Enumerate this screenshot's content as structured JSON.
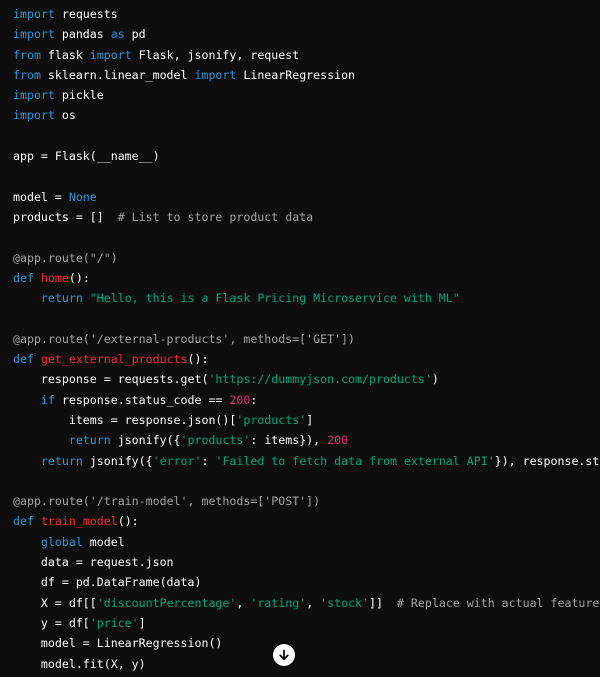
{
  "colors": {
    "background": "#0d0d0d",
    "keyword": "#2e95d3",
    "function_name": "#f22c3d",
    "string": "#00a67d",
    "number": "#df3079",
    "comment": "#a3a3a3",
    "default": "#ffffff"
  },
  "code_lines": [
    [
      [
        "kw",
        "import"
      ],
      [
        "tx",
        " requests"
      ]
    ],
    [
      [
        "kw",
        "import"
      ],
      [
        "tx",
        " pandas "
      ],
      [
        "kw",
        "as"
      ],
      [
        "tx",
        " pd"
      ]
    ],
    [
      [
        "kw",
        "from"
      ],
      [
        "tx",
        " flask "
      ],
      [
        "kw",
        "import"
      ],
      [
        "tx",
        " Flask, jsonify, request"
      ]
    ],
    [
      [
        "kw",
        "from"
      ],
      [
        "tx",
        " sklearn.linear_model "
      ],
      [
        "kw",
        "import"
      ],
      [
        "tx",
        " LinearRegression"
      ]
    ],
    [
      [
        "kw",
        "import"
      ],
      [
        "tx",
        " pickle"
      ]
    ],
    [
      [
        "kw",
        "import"
      ],
      [
        "tx",
        " os"
      ]
    ],
    [],
    [
      [
        "tx",
        "app = Flask(__name__)"
      ]
    ],
    [],
    [
      [
        "tx",
        "model = "
      ],
      [
        "kw",
        "None"
      ]
    ],
    [
      [
        "tx",
        "products = []  "
      ],
      [
        "cm",
        "# List to store product data"
      ]
    ],
    [],
    [
      [
        "cm",
        "@app.route(\"/\")"
      ]
    ],
    [
      [
        "kw",
        "def"
      ],
      [
        "tx",
        " "
      ],
      [
        "fn",
        "home"
      ],
      [
        "tx",
        "():"
      ]
    ],
    [
      [
        "tx",
        "    "
      ],
      [
        "kw",
        "return"
      ],
      [
        "tx",
        " "
      ],
      [
        "st",
        "\"Hello, this is a Flask Pricing Microservice with ML\""
      ]
    ],
    [],
    [
      [
        "cm",
        "@app.route('/external-products', methods=['GET'])"
      ]
    ],
    [
      [
        "kw",
        "def"
      ],
      [
        "tx",
        " "
      ],
      [
        "fn",
        "get_external_products"
      ],
      [
        "tx",
        "():"
      ]
    ],
    [
      [
        "tx",
        "    response = requests.get("
      ],
      [
        "st",
        "'https://dummyjson.com/products'"
      ],
      [
        "tx",
        ")"
      ]
    ],
    [
      [
        "tx",
        "    "
      ],
      [
        "kw",
        "if"
      ],
      [
        "tx",
        " response.status_code == "
      ],
      [
        "nu",
        "200"
      ],
      [
        "tx",
        ":"
      ]
    ],
    [
      [
        "tx",
        "        items = response.json()["
      ],
      [
        "st",
        "'products'"
      ],
      [
        "tx",
        "]"
      ]
    ],
    [
      [
        "tx",
        "        "
      ],
      [
        "kw",
        "return"
      ],
      [
        "tx",
        " jsonify({"
      ],
      [
        "st",
        "'products'"
      ],
      [
        "tx",
        ": items}), "
      ],
      [
        "nu",
        "200"
      ]
    ],
    [
      [
        "tx",
        "    "
      ],
      [
        "kw",
        "return"
      ],
      [
        "tx",
        " jsonify({"
      ],
      [
        "st",
        "'error'"
      ],
      [
        "tx",
        ": "
      ],
      [
        "st",
        "'Failed to fetch data from external API'"
      ],
      [
        "tx",
        "}), response.status_c"
      ]
    ],
    [],
    [
      [
        "cm",
        "@app.route('/train-model', methods=['POST'])"
      ]
    ],
    [
      [
        "kw",
        "def"
      ],
      [
        "tx",
        " "
      ],
      [
        "fn",
        "train_model"
      ],
      [
        "tx",
        "():"
      ]
    ],
    [
      [
        "tx",
        "    "
      ],
      [
        "kw",
        "global"
      ],
      [
        "tx",
        " model"
      ]
    ],
    [
      [
        "tx",
        "    data = request.json"
      ]
    ],
    [
      [
        "tx",
        "    df = pd.DataFrame(data)"
      ]
    ],
    [
      [
        "tx",
        "    X = df[["
      ],
      [
        "st",
        "'discountPercentage'"
      ],
      [
        "tx",
        ", "
      ],
      [
        "st",
        "'rating'"
      ],
      [
        "tx",
        ", "
      ],
      [
        "st",
        "'stock'"
      ],
      [
        "tx",
        "]]  "
      ],
      [
        "cm",
        "# Replace with actual feature names"
      ]
    ],
    [
      [
        "tx",
        "    y = df["
      ],
      [
        "st",
        "'price'"
      ],
      [
        "tx",
        "]"
      ]
    ],
    [
      [
        "tx",
        "    model = LinearRegression()"
      ]
    ],
    [
      [
        "tx",
        "    model.fit(X, y)"
      ]
    ]
  ],
  "scroll_button": {
    "icon": "arrow-down-icon"
  }
}
